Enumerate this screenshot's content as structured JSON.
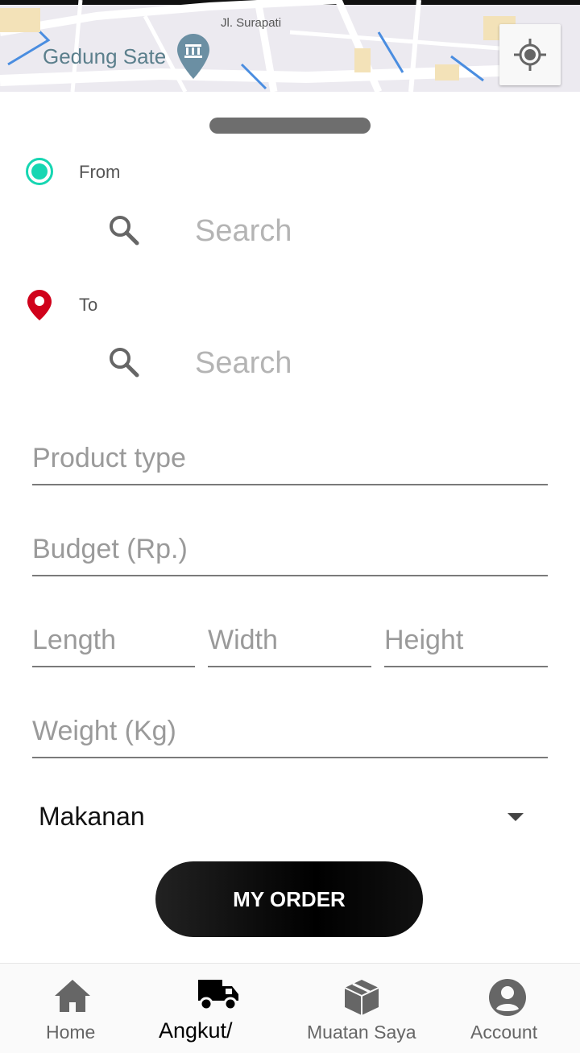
{
  "map": {
    "place_label": "Gedung Sate",
    "street_label": "Jl. Surapati",
    "locate_icon": "my-location-icon",
    "museum_icon": "museum-pin-icon"
  },
  "route": {
    "from_label": "From",
    "to_label": "To",
    "from_search_placeholder": "Search",
    "to_search_placeholder": "Search"
  },
  "form": {
    "product_type_placeholder": "Product type",
    "budget_placeholder": "Budget (Rp.)",
    "length_placeholder": "Length",
    "width_placeholder": "Width",
    "height_placeholder": "Height",
    "weight_placeholder": "Weight (Kg)",
    "category_selected": "Makanan"
  },
  "actions": {
    "order_label": "MY ORDER"
  },
  "nav": {
    "items": [
      {
        "label": "Home",
        "icon": "home-icon"
      },
      {
        "label": "Angkut/",
        "icon": "truck-icon",
        "active": true
      },
      {
        "label": "Muatan Saya",
        "icon": "package-icon"
      },
      {
        "label": "Account",
        "icon": "account-icon"
      }
    ]
  },
  "colors": {
    "from_accent": "#16d6b2",
    "to_accent": "#d0021b",
    "button_bg": "#000000"
  }
}
